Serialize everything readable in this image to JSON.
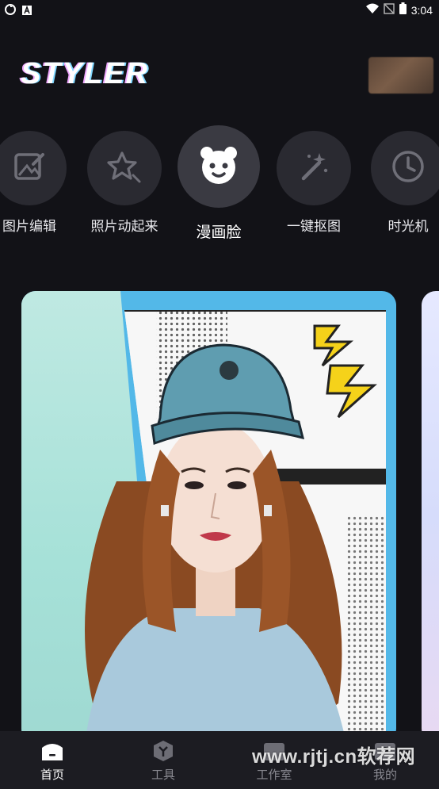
{
  "status_bar": {
    "time": "3:04"
  },
  "header": {
    "logo": "STYLER"
  },
  "tools": [
    {
      "label": "图片编辑",
      "icon": "edit-image-icon"
    },
    {
      "label": "照片动起来",
      "icon": "sparkle-star-icon"
    },
    {
      "label": "漫画脸",
      "icon": "bear-face-icon",
      "selected": true
    },
    {
      "label": "一键抠图",
      "icon": "magic-wand-icon"
    },
    {
      "label": "时光机",
      "icon": "clock-icon"
    }
  ],
  "nav": [
    {
      "label": "首页",
      "icon": "home-icon",
      "active": true
    },
    {
      "label": "工具",
      "icon": "tools-icon"
    },
    {
      "label": "工作室",
      "icon": "studio-icon"
    },
    {
      "label": "我的",
      "icon": "profile-icon"
    }
  ],
  "watermark": "www.rjtj.cn软荐网",
  "colors": {
    "background": "#121217",
    "card_accent": "#53b8e8",
    "nav_bg": "#1c1c22"
  }
}
